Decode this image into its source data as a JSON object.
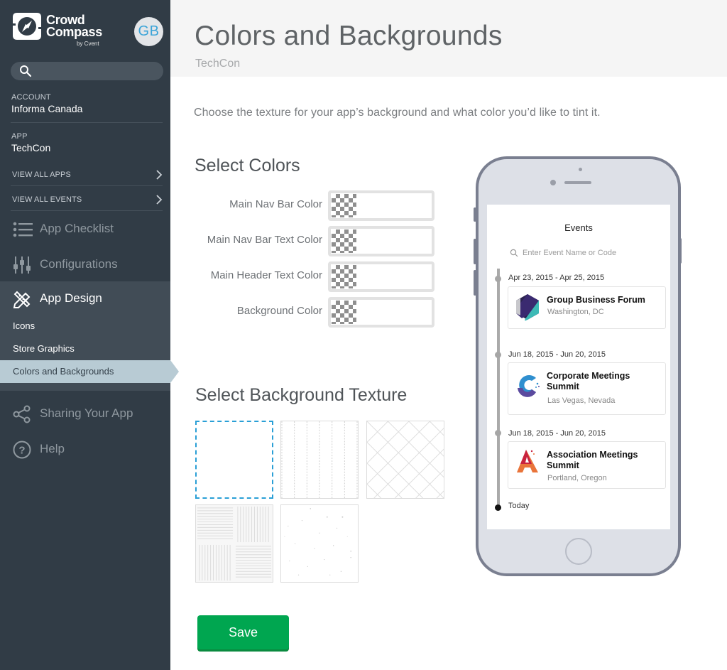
{
  "brand": {
    "name_line1": "Crowd",
    "name_line2": "Compass",
    "byline": "by Cvent"
  },
  "user": {
    "initials": "GB"
  },
  "sidebar": {
    "search": {
      "placeholder": "",
      "value": ""
    },
    "account": {
      "caption": "ACCOUNT",
      "value": "Informa Canada"
    },
    "app": {
      "caption": "APP",
      "value": "TechCon"
    },
    "links": [
      {
        "label": "VIEW ALL APPS"
      },
      {
        "label": "VIEW ALL EVENTS"
      }
    ],
    "nav": [
      {
        "label": "App Checklist",
        "icon": "list-icon"
      },
      {
        "label": "Configurations",
        "icon": "sliders-icon"
      },
      {
        "label": "App Design",
        "icon": "design-tools-icon"
      },
      {
        "label": "Sharing Your App",
        "icon": "share-icon"
      },
      {
        "label": "Help",
        "icon": "help-circle-icon"
      }
    ],
    "sub_items": [
      {
        "label": "Icons"
      },
      {
        "label": "Store Graphics"
      },
      {
        "label": "Colors and Backgrounds",
        "selected": true
      }
    ]
  },
  "header": {
    "title": "Colors and Backgrounds",
    "subtitle": "TechCon"
  },
  "main": {
    "description": "Choose the texture for your app’s background and what color you’d like to tint it.",
    "colors_title": "Select Colors",
    "color_fields": [
      {
        "label": "Main Nav Bar Color",
        "value": "transparent"
      },
      {
        "label": "Main Nav Bar Text Color",
        "value": "transparent"
      },
      {
        "label": "Main Header Text Color",
        "value": "transparent"
      },
      {
        "label": "Background Color",
        "value": "transparent"
      }
    ],
    "texture_title": "Select Background Texture",
    "textures": [
      {
        "name": "plain",
        "selected": true
      },
      {
        "name": "vertical-dotted-lines",
        "selected": false
      },
      {
        "name": "diagonal-grid",
        "selected": false
      },
      {
        "name": "basket-weave",
        "selected": false
      },
      {
        "name": "speckle",
        "selected": false
      }
    ],
    "save_label": "Save"
  },
  "preview": {
    "screen_title": "Events",
    "search_placeholder": "Enter Event Name or Code",
    "events": [
      {
        "date": "Apr 23, 2015 - Apr 25, 2015",
        "name": "Group Business Forum",
        "location": "Washington, DC"
      },
      {
        "date": "Jun 18, 2015 - Jun 20, 2015",
        "name": "Corporate Meetings Summit",
        "location": "Las Vegas, Nevada"
      },
      {
        "date": "Jun 18, 2015 - Jun 20, 2015",
        "name": "Association Meetings Summit",
        "location": "Portland, Oregon"
      }
    ],
    "today_label": "Today"
  },
  "colors": {
    "sidebar_bg": "#313c46",
    "selected_sub_item": "#b8cbd4",
    "save_button": "#00a650",
    "texture_selected_border": "#2a9fd6",
    "avatar_text": "#3ba4d8"
  }
}
